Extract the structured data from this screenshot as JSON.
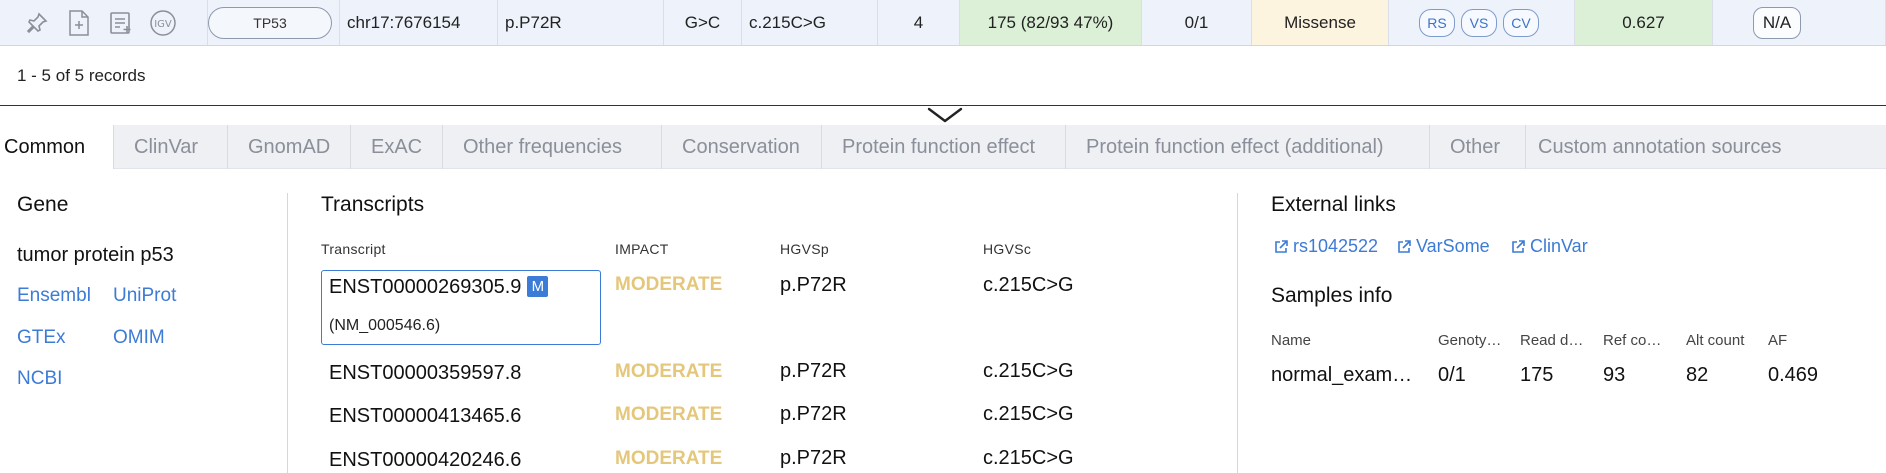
{
  "row": {
    "gene": "TP53",
    "position": "chr17:7676154",
    "protein_change": "p.P72R",
    "nucleotide_change": "G>C",
    "hgvsc": "c.215C>G",
    "count": "4",
    "depth": "175  (82/93 47%)",
    "genotype": "0/1",
    "effect": "Missense",
    "link_pills": [
      "RS",
      "VS",
      "CV"
    ],
    "score": "0.627",
    "na": "N/A",
    "icons": [
      "pin-icon",
      "add-file-icon",
      "playlist-add-icon",
      "igv-icon"
    ],
    "igv_label": "IGV"
  },
  "records_text": "1 - 5 of 5 records",
  "tabs": [
    "Common",
    "ClinVar",
    "GnomAD",
    "ExAC",
    "Other frequencies",
    "Conservation",
    "Protein function effect",
    "Protein function effect (additional)",
    "Other",
    "Custom annotation sources"
  ],
  "gene_panel": {
    "title": "Gene",
    "name": "tumor protein p53",
    "links": [
      "Ensembl",
      "UniProt",
      "GTEx",
      "OMIM",
      "NCBI"
    ]
  },
  "transcripts": {
    "title": "Transcripts",
    "headers": [
      "Transcript",
      "IMPACT",
      "HGVSp",
      "HGVSc"
    ],
    "mane_badge": "M",
    "rows": [
      {
        "id": "ENST00000269305.9",
        "refseq": "(NM_000546.6)",
        "impact": "MODERATE",
        "hgvsp": "p.P72R",
        "hgvsc": "c.215C>G"
      },
      {
        "id": "ENST00000359597.8",
        "impact": "MODERATE",
        "hgvsp": "p.P72R",
        "hgvsc": "c.215C>G"
      },
      {
        "id": "ENST00000413465.6",
        "impact": "MODERATE",
        "hgvsp": "p.P72R",
        "hgvsc": "c.215C>G"
      },
      {
        "id": "ENST00000420246.6",
        "impact": "MODERATE",
        "hgvsp": "p.P72R",
        "hgvsc": "c.215C>G"
      }
    ]
  },
  "external_links": {
    "title": "External links",
    "links": [
      "rs1042522",
      "VarSome",
      "ClinVar"
    ]
  },
  "samples": {
    "title": "Samples info",
    "headers": [
      "Name",
      "Genoty…",
      "Read d…",
      "Ref co…",
      "Alt count",
      "AF"
    ],
    "values": [
      "normal_exam…",
      "0/1",
      "175",
      "93",
      "82",
      "0.469"
    ]
  },
  "colors": {
    "link": "#3c7bd6",
    "impact_moderate": "#e4c77a",
    "score_bg": "#dbf0d6",
    "effect_bg": "#fcf4de"
  }
}
